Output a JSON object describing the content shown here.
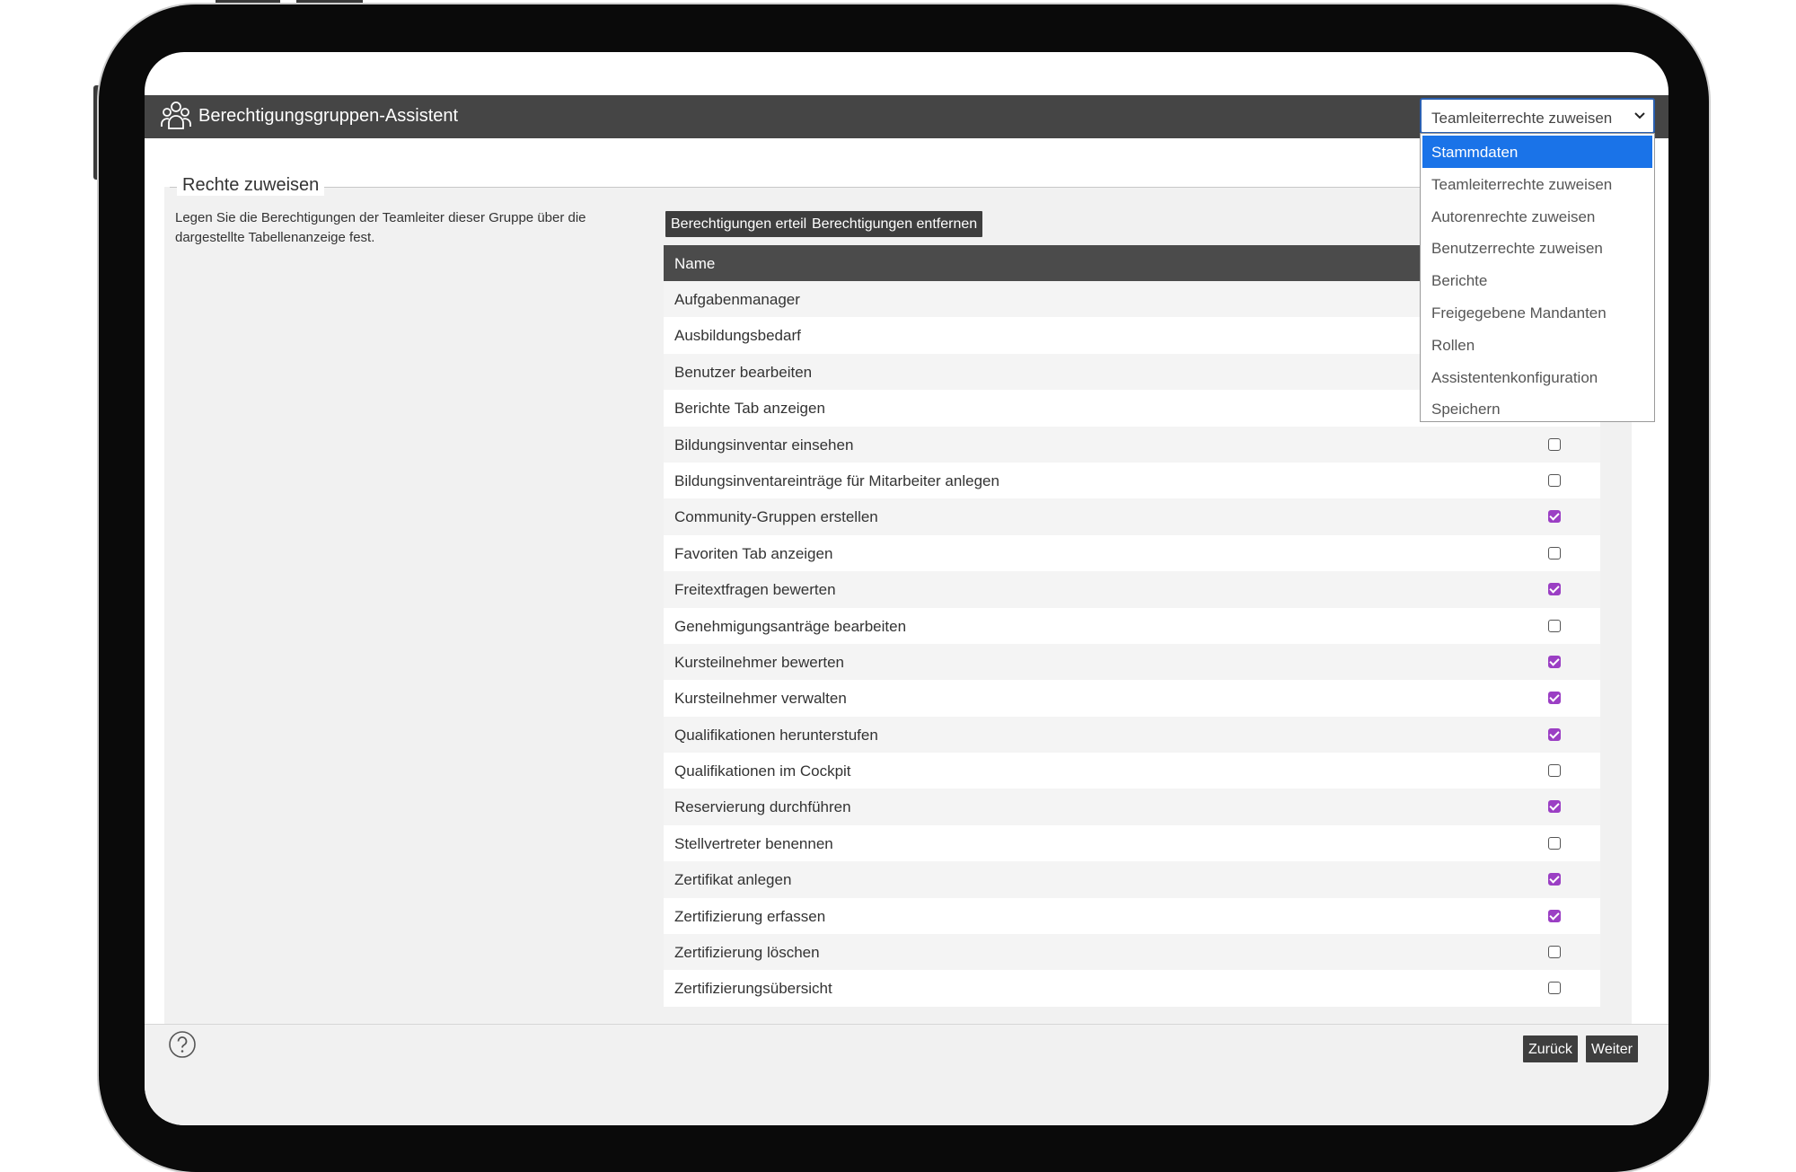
{
  "window": {
    "title": "Berechtigungsgruppen-Assistent"
  },
  "step_select": {
    "value": "Teamleiterrechte zuweisen",
    "options": [
      "Stammdaten",
      "Teamleiterrechte zuweisen",
      "Autorenrechte zuweisen",
      "Benutzerrechte zuweisen",
      "Berichte",
      "Freigegebene Mandanten",
      "Rollen",
      "Assistentenkonfiguration",
      "Speichern"
    ],
    "highlighted": "Stammdaten"
  },
  "section": {
    "legend": "Rechte zuweisen",
    "description": "Legen Sie die Berechtigungen der Teamleiter dieser Gruppe über die dargestellte Tabellenanzeige fest."
  },
  "actions": {
    "grant_label": "Berechtigungen erteilen",
    "revoke_label": "Berechtigungen entfernen"
  },
  "table": {
    "header_name": "Name",
    "rows": [
      {
        "name": "Aufgabenmanager",
        "checked": null
      },
      {
        "name": "Ausbildungsbedarf",
        "checked": null
      },
      {
        "name": "Benutzer bearbeiten",
        "checked": null
      },
      {
        "name": "Berichte Tab anzeigen",
        "checked": null
      },
      {
        "name": "Bildungsinventar einsehen",
        "checked": false
      },
      {
        "name": "Bildungsinventareinträge für Mitarbeiter anlegen",
        "checked": false
      },
      {
        "name": "Community-Gruppen erstellen",
        "checked": true
      },
      {
        "name": "Favoriten Tab anzeigen",
        "checked": false
      },
      {
        "name": "Freitextfragen bewerten",
        "checked": true
      },
      {
        "name": "Genehmigungsanträge bearbeiten",
        "checked": false
      },
      {
        "name": "Kursteilnehmer bewerten",
        "checked": true
      },
      {
        "name": "Kursteilnehmer verwalten",
        "checked": true
      },
      {
        "name": "Qualifikationen herunterstufen",
        "checked": true
      },
      {
        "name": "Qualifikationen im Cockpit",
        "checked": false
      },
      {
        "name": "Reservierung durchführen",
        "checked": true
      },
      {
        "name": "Stellvertreter benennen",
        "checked": false
      },
      {
        "name": "Zertifikat anlegen",
        "checked": true
      },
      {
        "name": "Zertifizierung erfassen",
        "checked": true
      },
      {
        "name": "Zertifizierung löschen",
        "checked": false
      },
      {
        "name": "Zertifizierungsübersicht",
        "checked": false
      }
    ]
  },
  "footer": {
    "back_label": "Zurück",
    "next_label": "Weiter"
  },
  "icons": {
    "title": "users-group-icon",
    "help": "help-circle-icon",
    "select_chevron": "chevron-down-icon"
  },
  "colors": {
    "header_bg": "#454545",
    "checkbox_checked": "#9b3fc4",
    "dropdown_highlight": "#1a73e8",
    "button_bg": "#3e3e3e"
  }
}
